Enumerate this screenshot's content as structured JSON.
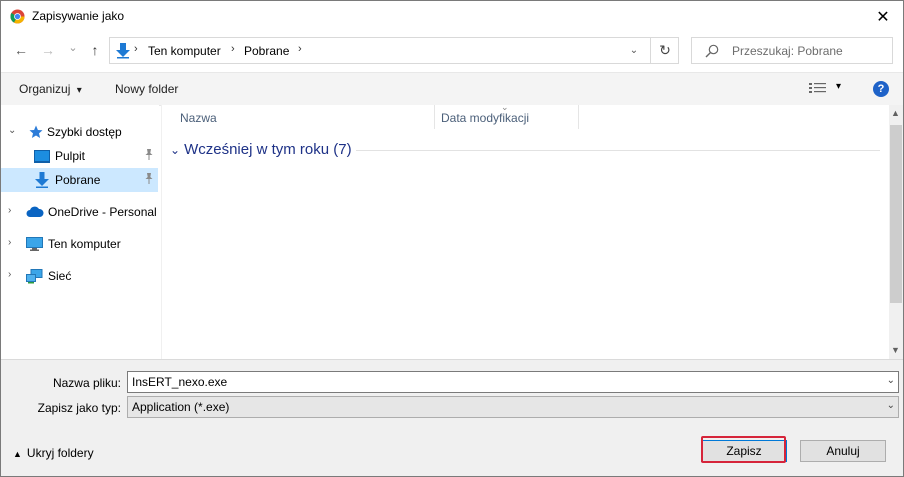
{
  "window": {
    "title": "Zapisywanie jako",
    "close_glyph": "✕"
  },
  "nav": {
    "back": "←",
    "forward": "→",
    "recent": "⌄",
    "up": "↑",
    "breadcrumb": [
      "Ten komputer",
      "Pobrane"
    ],
    "crumb_sep": "›",
    "dropdown": "⌄",
    "refresh": "↻",
    "search_placeholder": "Przeszukaj: Pobrane"
  },
  "toolbar": {
    "organize": "Organizuj",
    "organize_arrow": "▾",
    "new_folder": "Nowy folder",
    "view_arrow": "▾",
    "help": "?"
  },
  "sidebar": {
    "items": [
      {
        "label": "Szybki dostęp",
        "icon": "star-icon",
        "chevron": "⌄"
      },
      {
        "label": "Pulpit",
        "icon": "desktop-icon",
        "pinned": true
      },
      {
        "label": "Pobrane",
        "icon": "download-icon",
        "pinned": true,
        "selected": true
      },
      {
        "label": "OneDrive - Personal",
        "icon": "cloud-icon",
        "chevron": "›"
      },
      {
        "label": "Ten komputer",
        "icon": "computer-icon",
        "chevron": "›"
      },
      {
        "label": "Sieć",
        "icon": "network-icon",
        "chevron": "›"
      }
    ],
    "pin_glyph": "📌"
  },
  "list": {
    "columns": [
      "Nazwa",
      "Data modyfikacji"
    ],
    "group": "Wcześniej w tym roku (7)",
    "group_chevron": "⌄"
  },
  "form": {
    "filename_label": "Nazwa pliku:",
    "filename_value": "InsERT_nexo.exe",
    "filetype_label": "Zapisz jako typ:",
    "filetype_value": "Application (*.exe)"
  },
  "footer": {
    "hide_folders": "Ukryj foldery",
    "hide_arrow": "▲",
    "save": "Zapisz",
    "cancel": "Anuluj"
  },
  "colors": {
    "accent": "#0078d7",
    "highlight": "#d6243a",
    "selected": "#cce8ff"
  }
}
